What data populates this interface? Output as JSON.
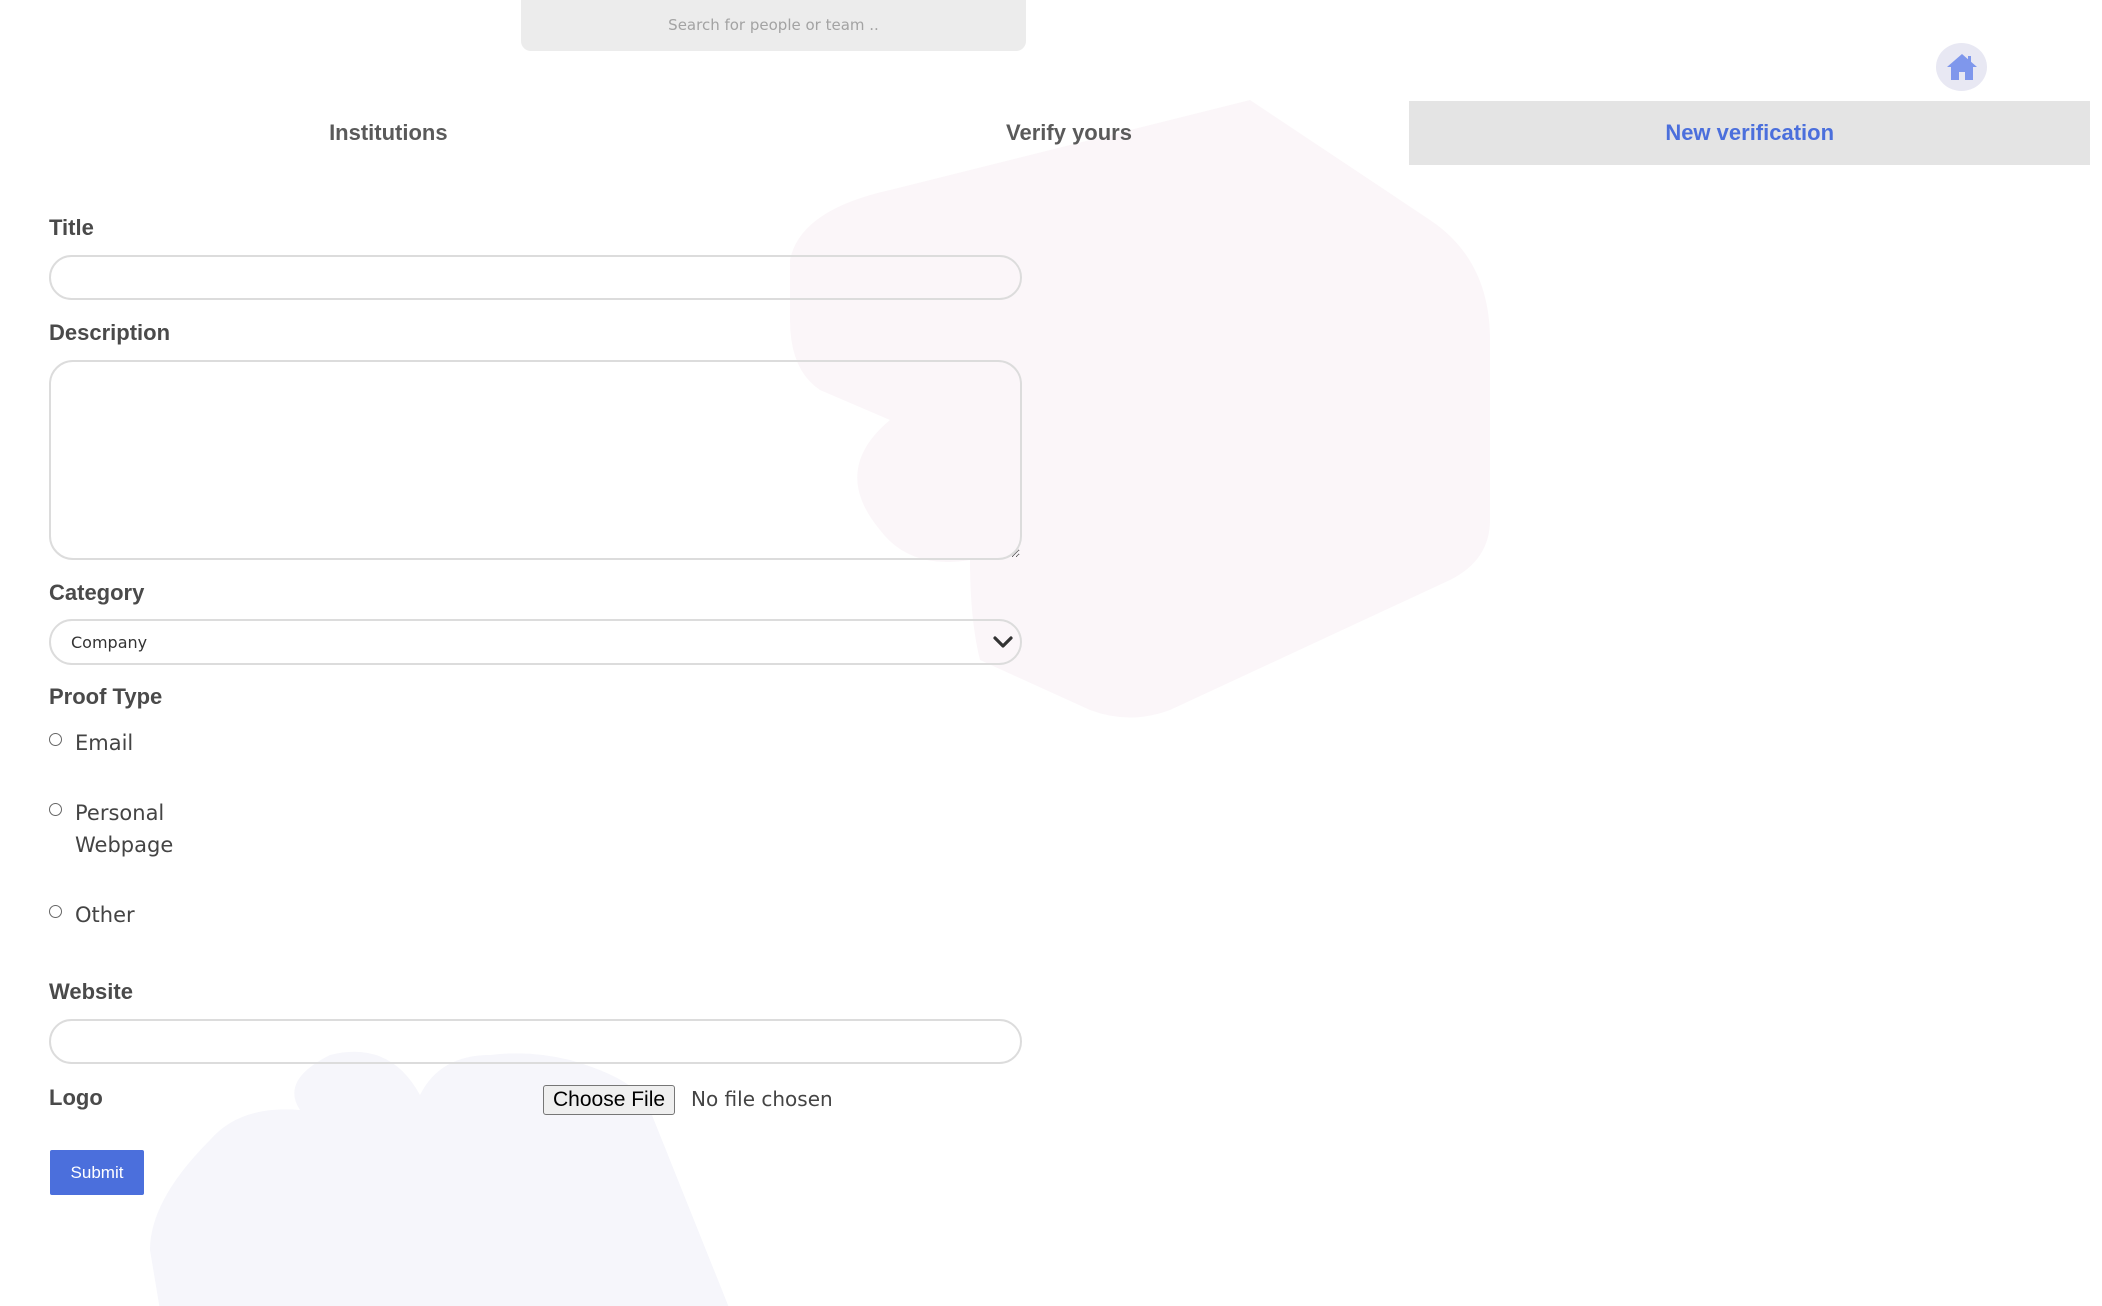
{
  "search": {
    "placeholder": "Search for people or team .."
  },
  "home": {
    "icon": "home-icon"
  },
  "tabs": [
    {
      "label": "Institutions",
      "active": false
    },
    {
      "label": "Verify yours",
      "active": false
    },
    {
      "label": "New verification",
      "active": true
    }
  ],
  "form": {
    "title_label": "Title",
    "title_value": "",
    "description_label": "Description",
    "description_value": "",
    "category_label": "Category",
    "category_selected": "Company",
    "proof_type_label": "Proof Type",
    "proof_options": [
      {
        "label": "Email",
        "checked": false
      },
      {
        "label": "Personal Webpage",
        "checked": false
      },
      {
        "label": "Other",
        "checked": false
      }
    ],
    "website_label": "Website",
    "website_value": "",
    "logo_label": "Logo",
    "choose_file_label": "Choose File",
    "file_status": "No file chosen",
    "submit_label": "Submit"
  },
  "colors": {
    "accent": "#4b6fdc",
    "tab_active_bg": "#e4e4e4",
    "home_bg": "#e8e8f3",
    "blob_pink": "#fbf6f9",
    "blob_lavender": "#f6f6fb"
  }
}
